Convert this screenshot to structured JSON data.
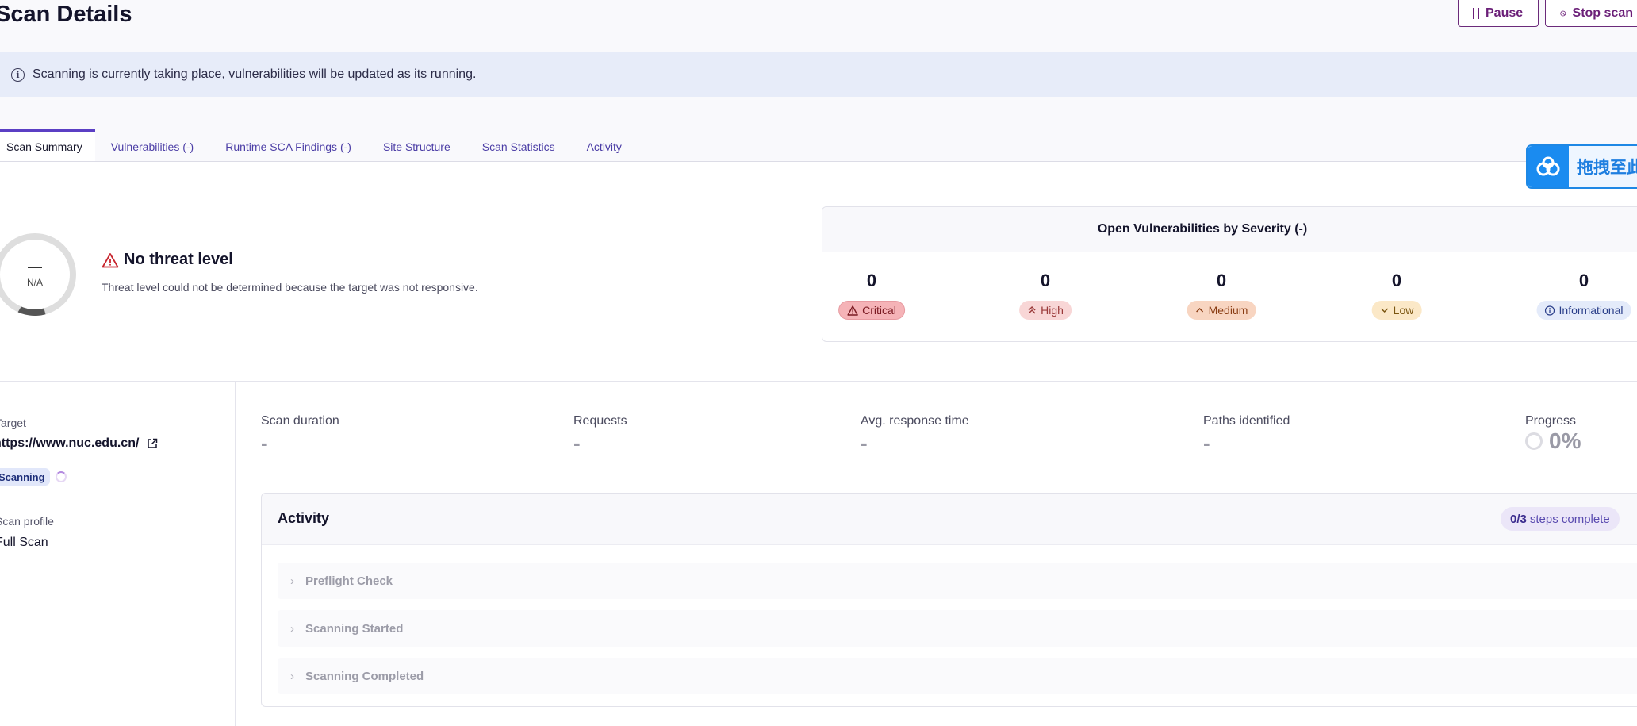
{
  "header": {
    "title": "Scan Details",
    "pause_label": "Pause",
    "stop_label": "Stop scan"
  },
  "banner": {
    "message": "Scanning is currently taking place, vulnerabilities will be updated as its running."
  },
  "tabs": [
    {
      "label": "Scan Summary",
      "active": true
    },
    {
      "label": "Vulnerabilities (-)"
    },
    {
      "label": "Runtime SCA Findings (-)"
    },
    {
      "label": "Site Structure"
    },
    {
      "label": "Scan Statistics"
    },
    {
      "label": "Activity"
    }
  ],
  "drop_widget": {
    "text": "拖拽至此"
  },
  "threat": {
    "gauge_dash": "—",
    "gauge_label": "N/A",
    "title": "No threat level",
    "description": "Threat level could not be determined because the target was not responsive."
  },
  "severity": {
    "title": "Open Vulnerabilities by Severity (-)",
    "items": [
      {
        "count": "0",
        "label": "Critical",
        "icon": "warning-icon"
      },
      {
        "count": "0",
        "label": "High",
        "icon": "double-chevron-up-icon"
      },
      {
        "count": "0",
        "label": "Medium",
        "icon": "chevron-up-icon"
      },
      {
        "count": "0",
        "label": "Low",
        "icon": "chevron-down-icon"
      },
      {
        "count": "0",
        "label": "Informational",
        "icon": "info-icon"
      }
    ]
  },
  "sidebar": {
    "target_label": "Target",
    "target_url": "https://www.nuc.edu.cn/",
    "status": "Scanning",
    "profile_label": "Scan profile",
    "profile_value": "Full Scan"
  },
  "stats": {
    "duration_label": "Scan duration",
    "duration_value": "-",
    "requests_label": "Requests",
    "requests_value": "-",
    "avg_label": "Avg. response time",
    "avg_value": "-",
    "paths_label": "Paths identified",
    "paths_value": "-",
    "progress_label": "Progress",
    "progress_value": "0%"
  },
  "activity": {
    "title": "Activity",
    "steps_done": "0/3",
    "steps_suffix": "steps complete",
    "steps": [
      {
        "label": "Preflight Check"
      },
      {
        "label": "Scanning Started"
      },
      {
        "label": "Scanning Completed"
      }
    ]
  },
  "colors": {
    "accent": "#5b3fc4",
    "brand_button": "#6b1f78",
    "banner_bg": "#e7ecf9"
  }
}
